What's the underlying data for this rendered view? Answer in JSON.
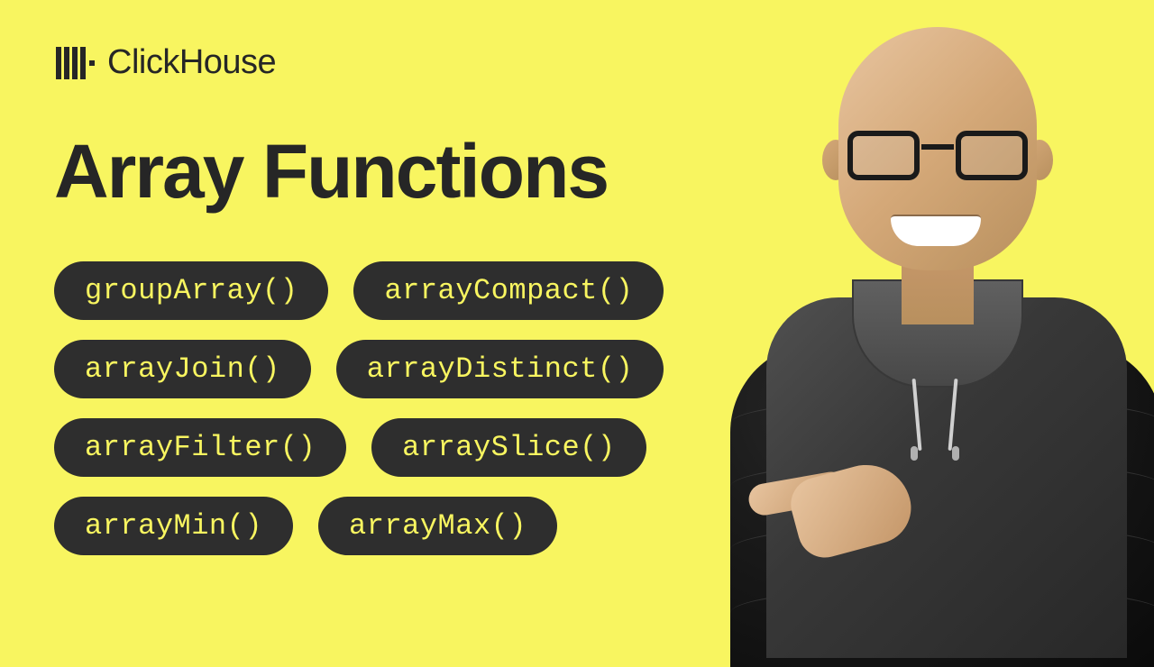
{
  "brand": "ClickHouse",
  "title": "Array Functions",
  "pills": {
    "row1": {
      "a": "groupArray()",
      "b": "arrayCompact()"
    },
    "row2": {
      "a": "arrayJoin()",
      "b": "arrayDistinct()"
    },
    "row3": {
      "a": "arrayFilter()",
      "b": "arraySlice()"
    },
    "row4": {
      "a": "arrayMin()",
      "b": "arrayMax()"
    }
  }
}
